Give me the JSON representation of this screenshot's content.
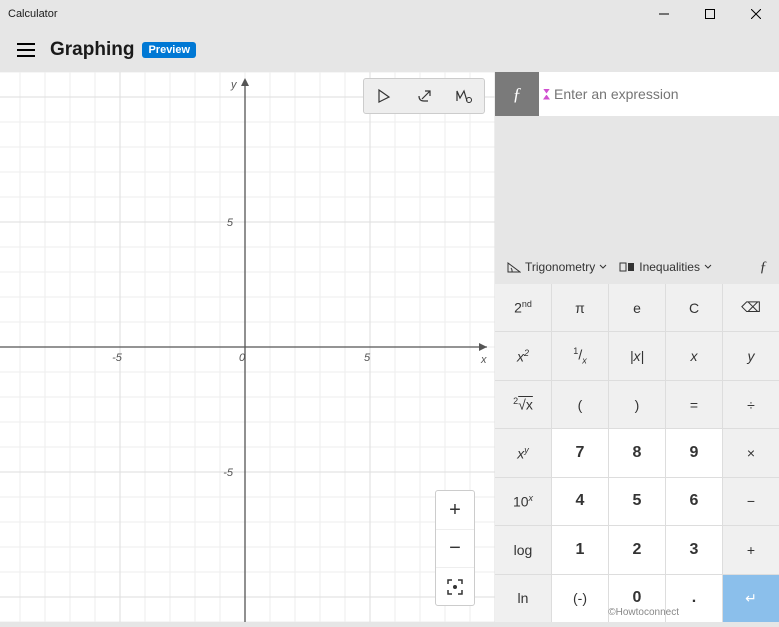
{
  "titlebar": {
    "title": "Calculator"
  },
  "header": {
    "mode": "Graphing",
    "badge": "Preview"
  },
  "graph": {
    "x_axis_label": "x",
    "y_axis_label": "y",
    "x_ticks": [
      {
        "v": -5,
        "l": "-5"
      },
      {
        "v": 0,
        "l": "0"
      },
      {
        "v": 5,
        "l": "5"
      }
    ],
    "y_ticks": [
      {
        "v": -5,
        "l": "-5"
      },
      {
        "v": 5,
        "l": "5"
      }
    ]
  },
  "expression": {
    "placeholder": "Enter an expression"
  },
  "categories": {
    "trig": "Trigonometry",
    "ineq": "Inequalities"
  },
  "keys": {
    "second": "2",
    "second_sup": "nd",
    "pi": "π",
    "e": "e",
    "clear": "C",
    "back": "⌫",
    "xsq": "x",
    "xsq_sup": "2",
    "recip_a": "1",
    "recip_b": "x",
    "abs": "|x|",
    "xvar": "x",
    "yvar": "y",
    "nroot_pre": "2",
    "nroot": "√x",
    "lparen": "(",
    "rparen": ")",
    "eq": "=",
    "div": "÷",
    "xy": "x",
    "xy_sup": "y",
    "k7": "7",
    "k8": "8",
    "k9": "9",
    "mul": "×",
    "tenx": "10",
    "tenx_sup": "x",
    "k4": "4",
    "k5": "5",
    "k6": "6",
    "sub": "−",
    "log": "log",
    "k1": "1",
    "k2": "2",
    "k3": "3",
    "add": "+",
    "ln": "ln",
    "neg": "(-)",
    "k0": "0",
    "dot": ".",
    "enter": "↵"
  },
  "watermark": "©Howtoconnect"
}
